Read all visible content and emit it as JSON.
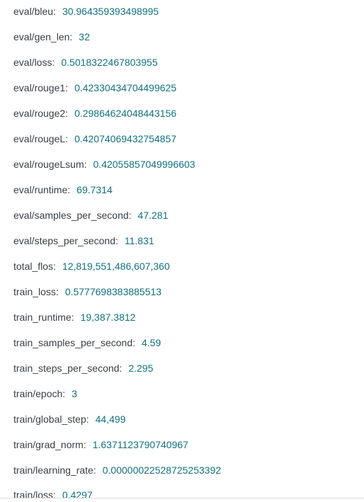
{
  "metrics": [
    {
      "key": "eval/bleu:",
      "value": "30.964359393498995"
    },
    {
      "key": "eval/gen_len:",
      "value": "32"
    },
    {
      "key": "eval/loss:",
      "value": "0.5018322467803955"
    },
    {
      "key": "eval/rouge1:",
      "value": "0.42330434704499625"
    },
    {
      "key": "eval/rouge2:",
      "value": "0.29864624048443156"
    },
    {
      "key": "eval/rougeL:",
      "value": "0.42074069432754857"
    },
    {
      "key": "eval/rougeLsum:",
      "value": "0.42055857049996603"
    },
    {
      "key": "eval/runtime:",
      "value": "69.7314"
    },
    {
      "key": "eval/samples_per_second:",
      "value": "47.281"
    },
    {
      "key": "eval/steps_per_second:",
      "value": "11.831"
    },
    {
      "key": "total_flos:",
      "value": "12,819,551,486,607,360"
    },
    {
      "key": "train_loss:",
      "value": "0.5777698383885513"
    },
    {
      "key": "train_runtime:",
      "value": "19,387.3812"
    },
    {
      "key": "train_samples_per_second:",
      "value": "4.59"
    },
    {
      "key": "train_steps_per_second:",
      "value": "2.295"
    },
    {
      "key": "train/epoch:",
      "value": "3"
    },
    {
      "key": "train/global_step:",
      "value": "44,499"
    },
    {
      "key": "train/grad_norm:",
      "value": "1.6371123790740967"
    },
    {
      "key": "train/learning_rate:",
      "value": "0.00000022528725253392"
    },
    {
      "key": "train/loss:",
      "value": "0.4297"
    }
  ]
}
